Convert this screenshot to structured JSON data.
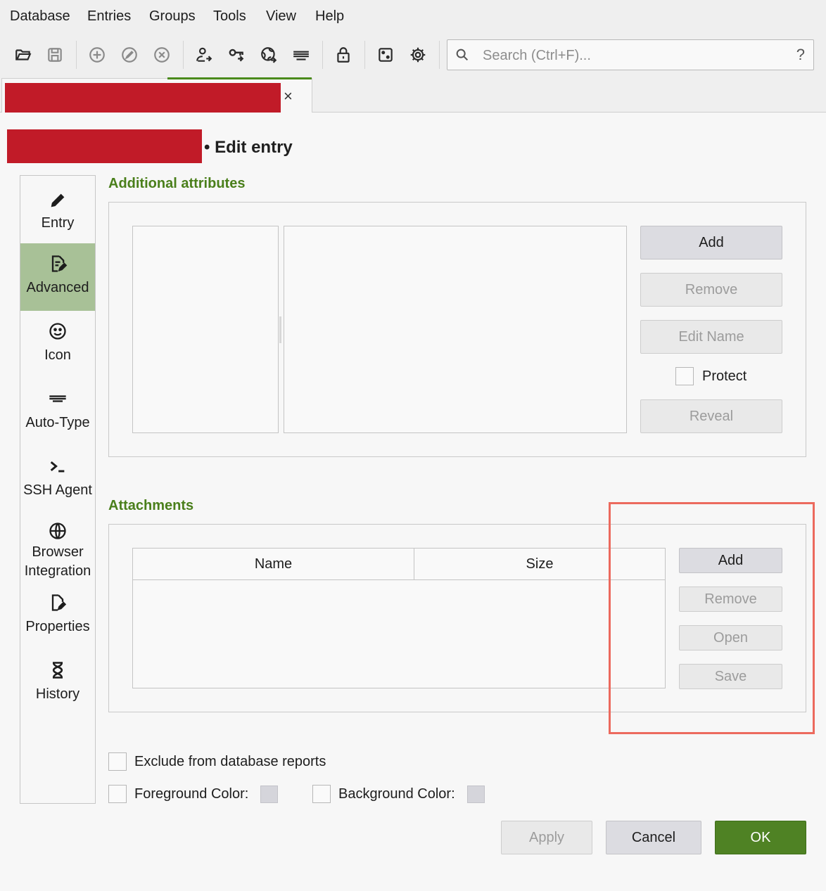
{
  "menu": {
    "items": [
      "Database",
      "Entries",
      "Groups",
      "Tools",
      "View",
      "Help"
    ]
  },
  "toolbar": {
    "icons": [
      "open-database-icon",
      "save-database-icon",
      "add-entry-icon",
      "edit-entry-icon",
      "delete-entry-icon",
      "copy-username-icon",
      "copy-password-icon",
      "copy-url-icon",
      "autotype-icon",
      "lock-icon",
      "password-generator-icon",
      "settings-icon"
    ],
    "search_placeholder": "Search (Ctrl+F)...",
    "search_help": "?"
  },
  "tab": {
    "close_label": "×"
  },
  "page": {
    "title": "• Edit entry"
  },
  "sidebar": {
    "items": [
      {
        "label": "Entry",
        "icon": "pencil-icon"
      },
      {
        "label": "Advanced",
        "icon": "document-edit-icon"
      },
      {
        "label": "Icon",
        "icon": "smiley-icon"
      },
      {
        "label": "Auto-Type",
        "icon": "keyboard-icon"
      },
      {
        "label": "SSH Agent",
        "icon": "terminal-icon"
      },
      {
        "label": "Browser Integration",
        "icon": "globe-icon"
      },
      {
        "label": "Properties",
        "icon": "file-edit-icon"
      },
      {
        "label": "History",
        "icon": "hourglass-icon"
      }
    ]
  },
  "attributes": {
    "title": "Additional attributes",
    "add": "Add",
    "remove": "Remove",
    "edit_name": "Edit Name",
    "protect": "Protect",
    "reveal": "Reveal"
  },
  "attachments": {
    "title": "Attachments",
    "columns": [
      "Name",
      "Size"
    ],
    "add": "Add",
    "remove": "Remove",
    "open": "Open",
    "save": "Save"
  },
  "options": {
    "exclude_reports": "Exclude from database reports",
    "foreground_color": "Foreground Color:",
    "background_color": "Background Color:"
  },
  "footer": {
    "apply": "Apply",
    "cancel": "Cancel",
    "ok": "OK"
  },
  "colors": {
    "accent": "#4a7f1b",
    "active_nav": "#a8c197",
    "redaction": "#c11b28",
    "highlight": "#ec6a5e",
    "ok_button": "#4f8224"
  }
}
